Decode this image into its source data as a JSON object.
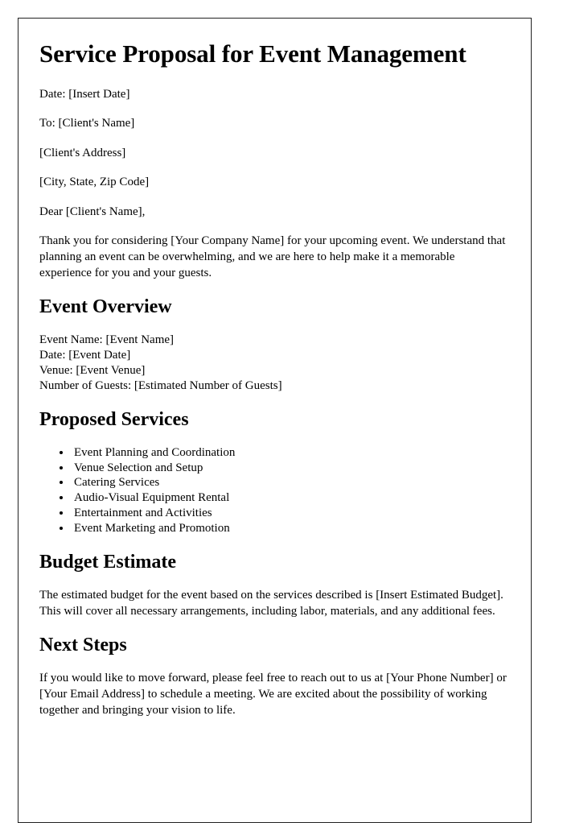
{
  "document": {
    "title": "Service Proposal for Event Management",
    "header_lines": [
      "Date: [Insert Date]",
      "To: [Client's Name]",
      "[Client's Address]",
      "[City, State, Zip Code]",
      "Dear [Client's Name],"
    ],
    "intro_paragraph": "Thank you for considering [Your Company Name] for your upcoming event. We understand that planning an event can be overwhelming, and we are here to help make it a memorable experience for you and your guests.",
    "sections": [
      {
        "heading": "Event Overview",
        "details": [
          "Event Name: [Event Name]",
          "Date: [Event Date]",
          "Venue: [Event Venue]",
          "Number of Guests: [Estimated Number of Guests]"
        ]
      },
      {
        "heading": "Proposed Services",
        "items": [
          "Event Planning and Coordination",
          "Venue Selection and Setup",
          "Catering Services",
          "Audio-Visual Equipment Rental",
          "Entertainment and Activities",
          "Event Marketing and Promotion"
        ]
      },
      {
        "heading": "Budget Estimate",
        "paragraph": "The estimated budget for the event based on the services described is [Insert Estimated Budget]. This will cover all necessary arrangements, including labor, materials, and any additional fees."
      },
      {
        "heading": "Next Steps",
        "paragraph": "If you would like to move forward, please feel free to reach out to us at [Your Phone Number] or [Your Email Address] to schedule a meeting. We are excited about the possibility of working together and bringing your vision to life."
      }
    ]
  }
}
